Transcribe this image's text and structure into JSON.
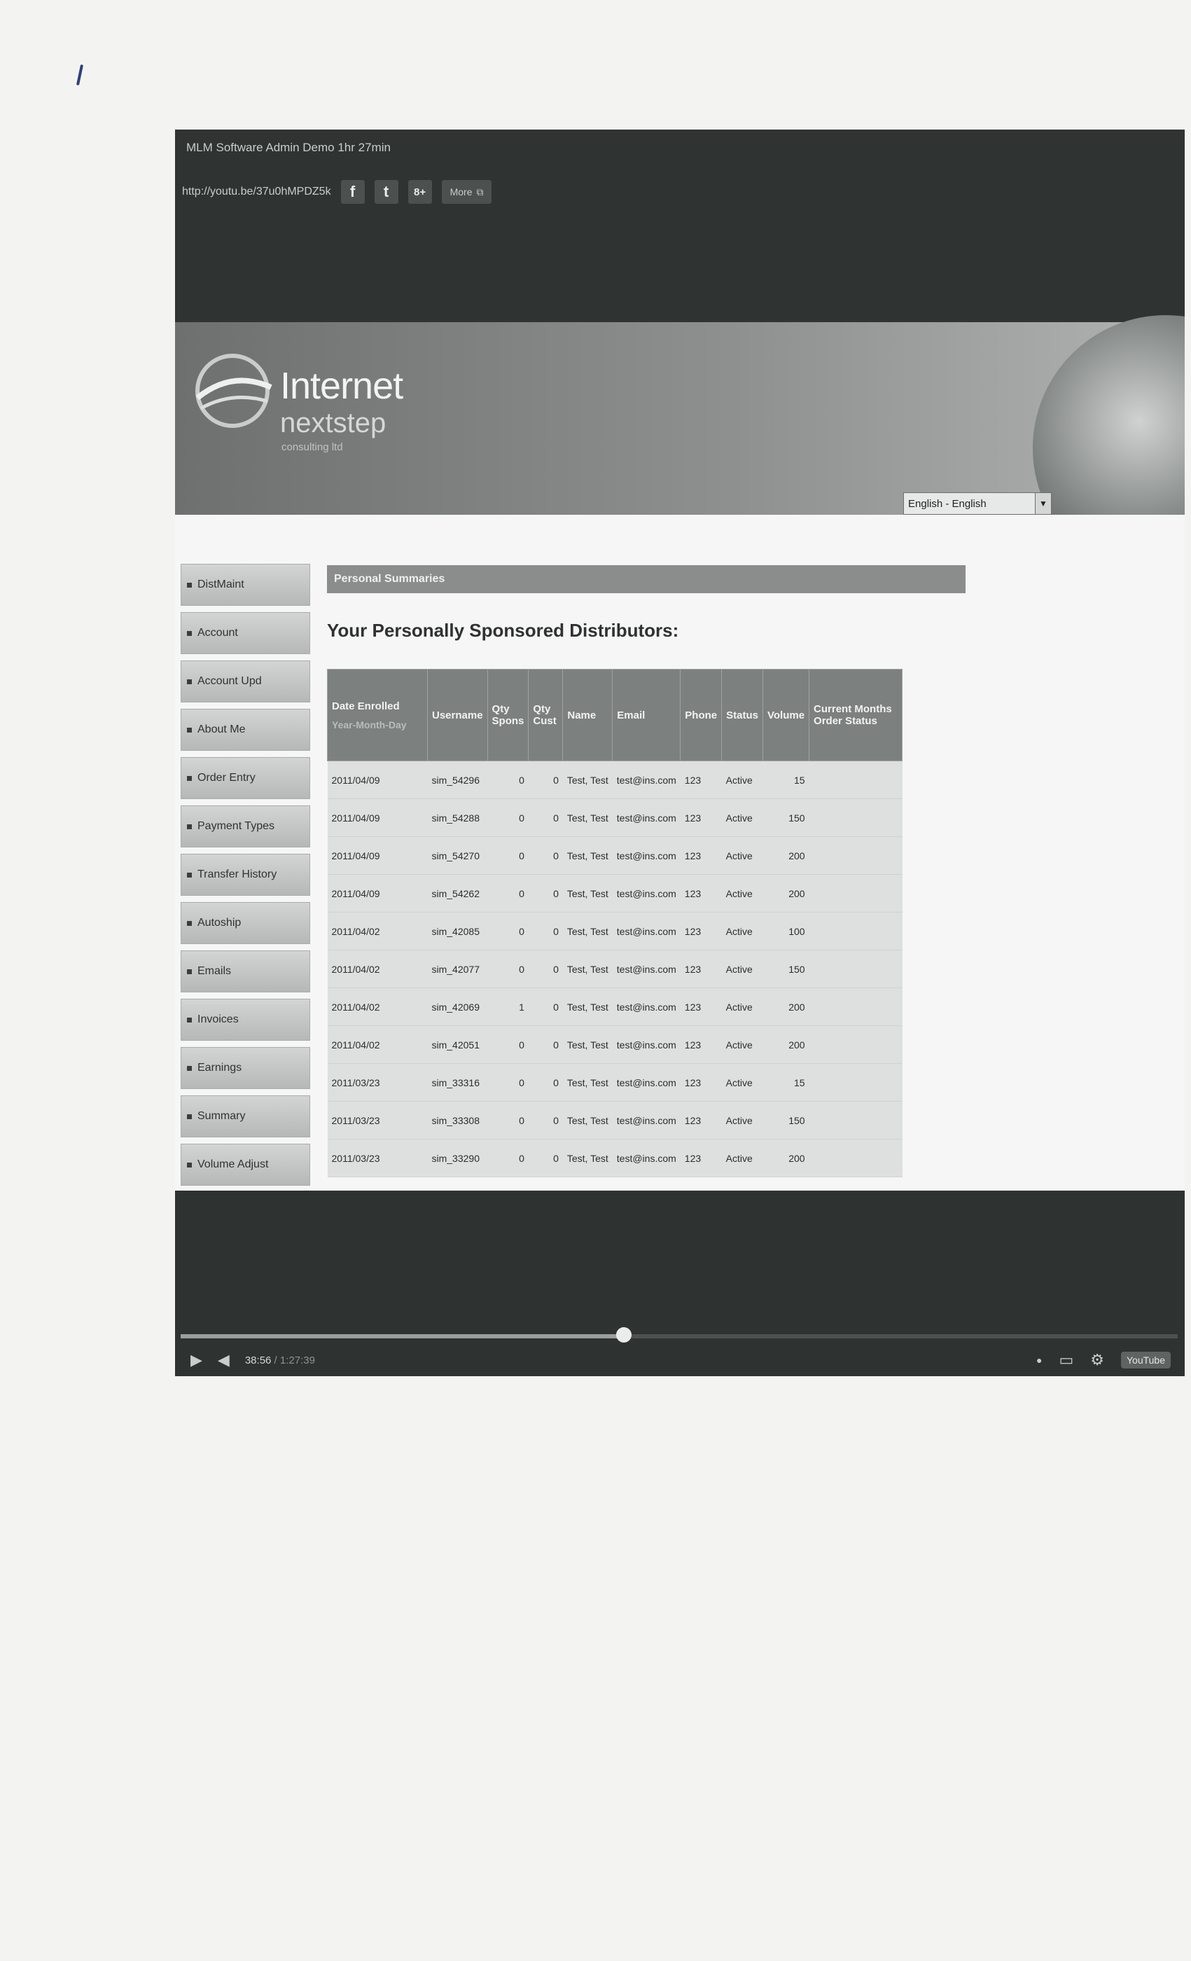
{
  "video": {
    "title": "MLM Software Admin Demo 1hr 27min",
    "share_url": "http://youtu.be/37u0hMPDZ5k",
    "share_icons": [
      "facebook-icon",
      "twitter-icon",
      "google-plus-icon"
    ],
    "share_glyphs": {
      "facebook": "f",
      "twitter": "t",
      "google_plus": "8+"
    },
    "more_label": "More"
  },
  "site": {
    "logo_main": "Internet",
    "logo_sub": "nextstep",
    "logo_sub2": "consulting ltd",
    "language_value": "English - English"
  },
  "sidebar": {
    "items": [
      {
        "label": "DistMaint"
      },
      {
        "label": "Account"
      },
      {
        "label": "Account Upd"
      },
      {
        "label": "About Me"
      },
      {
        "label": "Order Entry"
      },
      {
        "label": "Payment Types"
      },
      {
        "label": "Transfer History"
      },
      {
        "label": "Autoship"
      },
      {
        "label": "Emails"
      },
      {
        "label": "Invoices"
      },
      {
        "label": "Earnings"
      },
      {
        "label": "Summary"
      },
      {
        "label": "Volume Adjust"
      }
    ]
  },
  "main": {
    "section_title": "Personal Summaries",
    "heading": "Your Personally Sponsored Distributors:",
    "columns": [
      "Date Enrolled",
      "Username",
      "Qty Spons",
      "Qty Cust",
      "Name",
      "Email",
      "Phone",
      "Status",
      "Volume",
      "Current Months Order Status"
    ],
    "date_subheader": "Year-Month-Day",
    "rows": [
      [
        "2011/04/09",
        "sim_54296",
        "0",
        "0",
        "Test, Test",
        "test@ins.com",
        "123",
        "Active",
        "15",
        ""
      ],
      [
        "2011/04/09",
        "sim_54288",
        "0",
        "0",
        "Test, Test",
        "test@ins.com",
        "123",
        "Active",
        "150",
        ""
      ],
      [
        "2011/04/09",
        "sim_54270",
        "0",
        "0",
        "Test, Test",
        "test@ins.com",
        "123",
        "Active",
        "200",
        ""
      ],
      [
        "2011/04/09",
        "sim_54262",
        "0",
        "0",
        "Test, Test",
        "test@ins.com",
        "123",
        "Active",
        "200",
        ""
      ],
      [
        "2011/04/02",
        "sim_42085",
        "0",
        "0",
        "Test, Test",
        "test@ins.com",
        "123",
        "Active",
        "100",
        ""
      ],
      [
        "2011/04/02",
        "sim_42077",
        "0",
        "0",
        "Test, Test",
        "test@ins.com",
        "123",
        "Active",
        "150",
        ""
      ],
      [
        "2011/04/02",
        "sim_42069",
        "1",
        "0",
        "Test, Test",
        "test@ins.com",
        "123",
        "Active",
        "200",
        ""
      ],
      [
        "2011/04/02",
        "sim_42051",
        "0",
        "0",
        "Test, Test",
        "test@ins.com",
        "123",
        "Active",
        "200",
        ""
      ],
      [
        "2011/03/23",
        "sim_33316",
        "0",
        "0",
        "Test, Test",
        "test@ins.com",
        "123",
        "Active",
        "15",
        ""
      ],
      [
        "2011/03/23",
        "sim_33308",
        "0",
        "0",
        "Test, Test",
        "test@ins.com",
        "123",
        "Active",
        "150",
        ""
      ],
      [
        "2011/03/23",
        "sim_33290",
        "0",
        "0",
        "Test, Test",
        "test@ins.com",
        "123",
        "Active",
        "200",
        ""
      ]
    ]
  },
  "player": {
    "current_time": "38:56",
    "duration": "1:27:39",
    "time_separator": " / ",
    "progress_fraction": 0.4442,
    "play_glyph": "▶",
    "volume_glyph": "◀",
    "hd_glyph": "⚙",
    "cc_glyph": "▭",
    "info_glyph": "●",
    "youtube_label": "YouTube"
  }
}
